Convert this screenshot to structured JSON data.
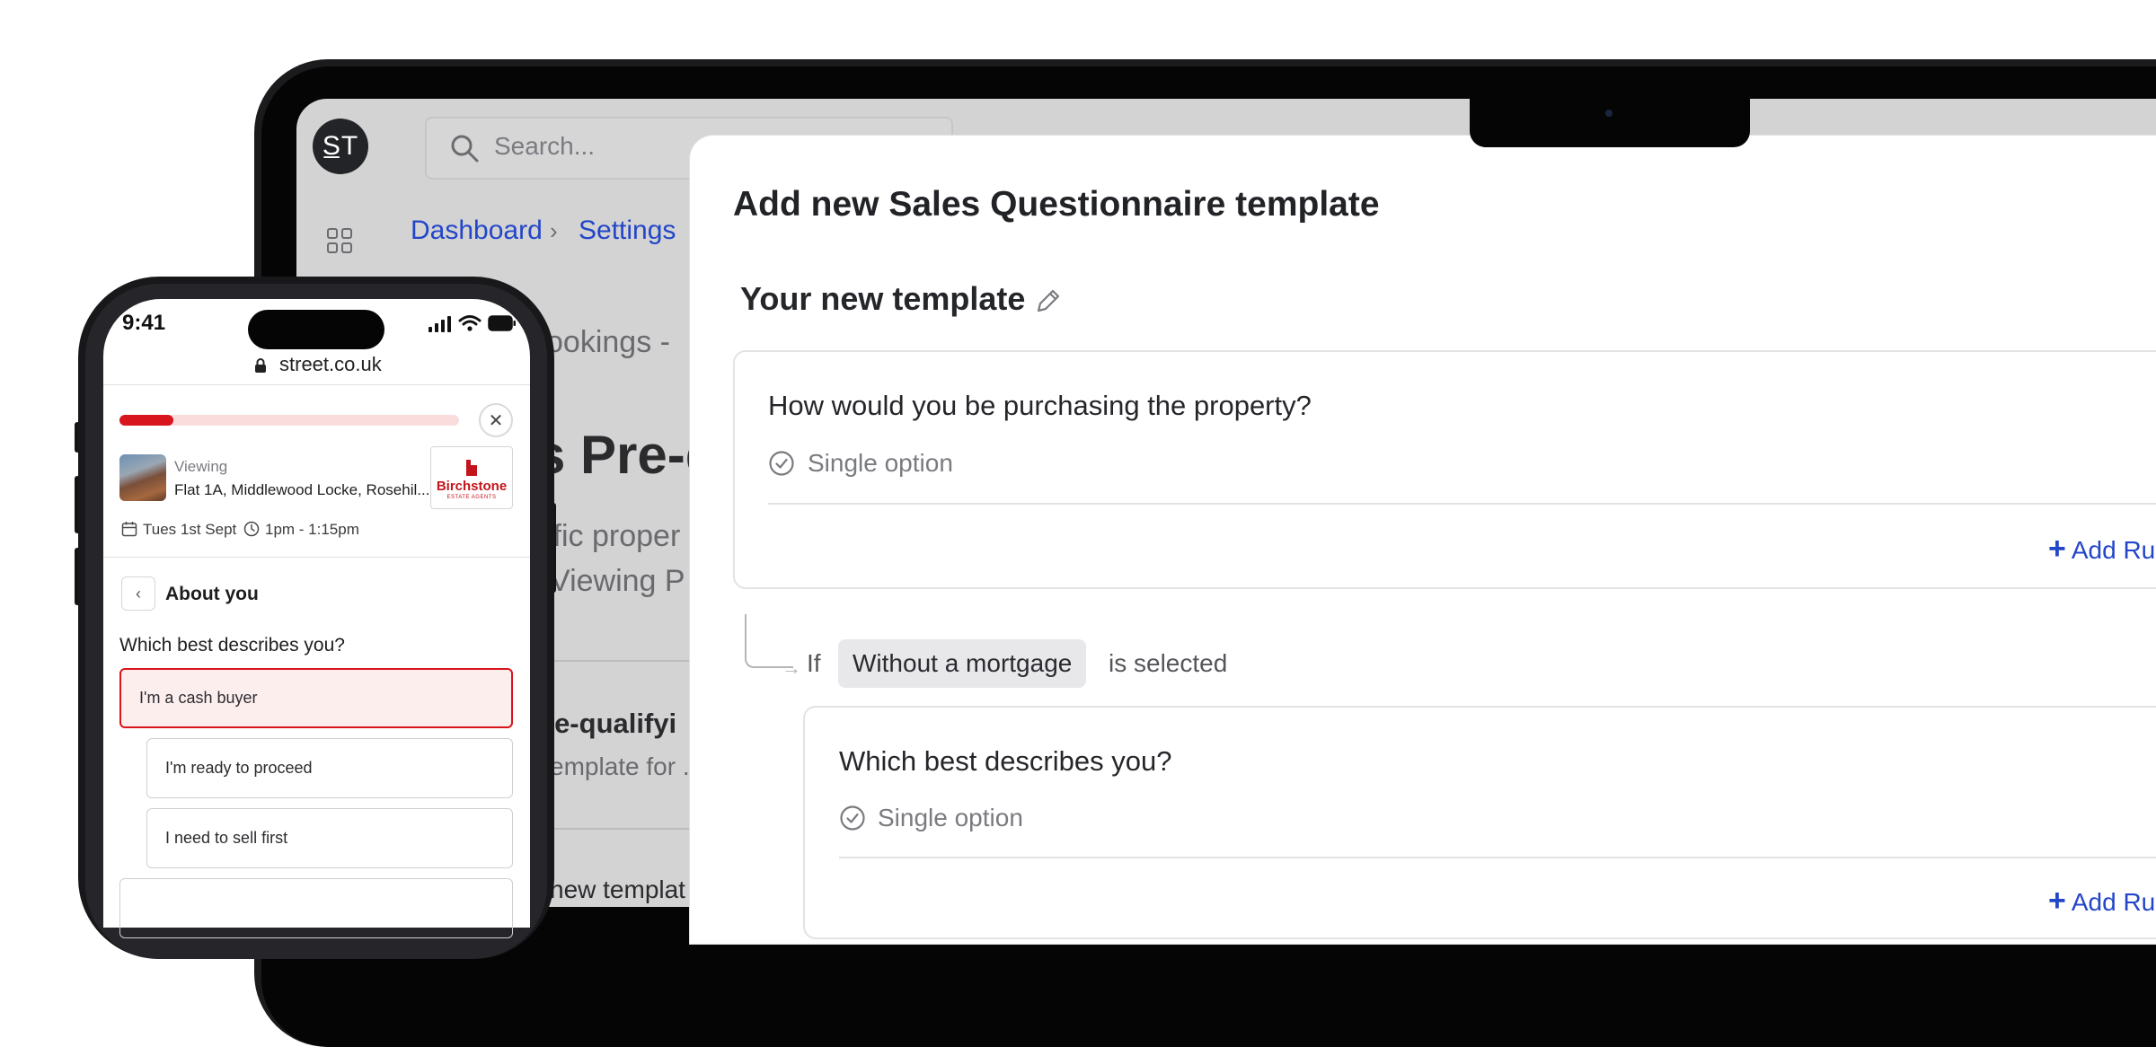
{
  "app": {
    "logo_text": "S̲T",
    "search_placeholder": "Search...",
    "breadcrumb": [
      "Dashboard",
      "Settings"
    ],
    "background_page": {
      "subtitle": "ookings -",
      "heading": "s Pre-q",
      "desc_line1": "ific proper",
      "desc_line2": "Viewing P",
      "item_title": "re-qualifyi",
      "item_desc": "emplate for .",
      "next_item": "new templat"
    }
  },
  "modal": {
    "title": "Add new Sales Questionnaire template",
    "template_name": "Your new template",
    "questions": [
      {
        "title": "How would you be purchasing the property?",
        "type": "Single option",
        "add_rule": "Add Ru"
      },
      {
        "title": "Which best describes you?",
        "type": "Single option",
        "add_rule": "Add Ru"
      }
    ],
    "rule": {
      "if": "If",
      "option": "Without a mortgage",
      "suffix": "is selected"
    }
  },
  "phone": {
    "time": "9:41",
    "url": "street.co.uk",
    "progress": 0.16,
    "viewing_label": "Viewing",
    "address": "Flat 1A, Middlewood Locke, Rosehil...",
    "agent_name": "Birchstone",
    "agent_sub": "ESTATE AGENTS",
    "date": "Tues 1st Sept",
    "time_range": "1pm - 1:15pm",
    "section": "About you",
    "question": "Which best describes you?",
    "options": [
      "I'm a cash buyer",
      "I'm ready to proceed",
      "I need to sell first"
    ],
    "selected_option": "I'm a cash buyer",
    "accent": "#d8151d"
  },
  "colors": {
    "link": "#2346c8",
    "screen_dim": "#d3d3d4"
  }
}
